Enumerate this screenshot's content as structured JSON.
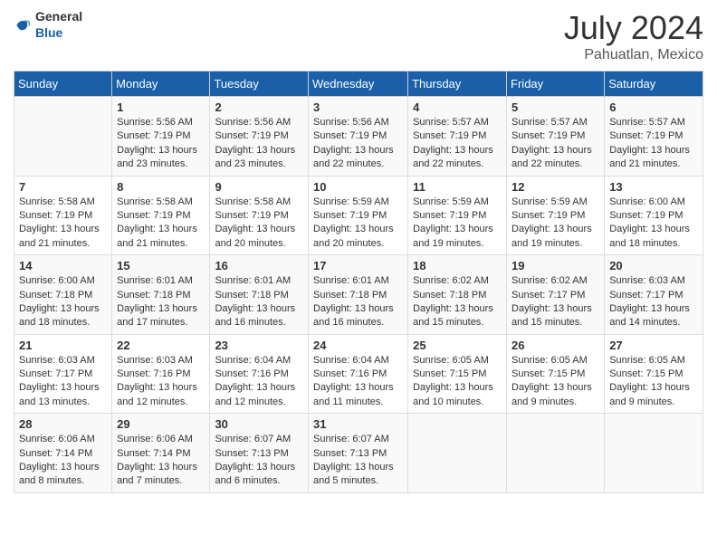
{
  "header": {
    "logo": {
      "general": "General",
      "blue": "Blue"
    },
    "title": "July 2024",
    "location": "Pahuatlan, Mexico"
  },
  "calendar": {
    "days_of_week": [
      "Sunday",
      "Monday",
      "Tuesday",
      "Wednesday",
      "Thursday",
      "Friday",
      "Saturday"
    ],
    "weeks": [
      [
        {
          "day": null
        },
        {
          "day": 1,
          "sunrise": "5:56 AM",
          "sunset": "7:19 PM",
          "daylight": "13 hours and 23 minutes."
        },
        {
          "day": 2,
          "sunrise": "5:56 AM",
          "sunset": "7:19 PM",
          "daylight": "13 hours and 23 minutes."
        },
        {
          "day": 3,
          "sunrise": "5:56 AM",
          "sunset": "7:19 PM",
          "daylight": "13 hours and 22 minutes."
        },
        {
          "day": 4,
          "sunrise": "5:57 AM",
          "sunset": "7:19 PM",
          "daylight": "13 hours and 22 minutes."
        },
        {
          "day": 5,
          "sunrise": "5:57 AM",
          "sunset": "7:19 PM",
          "daylight": "13 hours and 22 minutes."
        },
        {
          "day": 6,
          "sunrise": "5:57 AM",
          "sunset": "7:19 PM",
          "daylight": "13 hours and 21 minutes."
        }
      ],
      [
        {
          "day": 7,
          "sunrise": "5:58 AM",
          "sunset": "7:19 PM",
          "daylight": "13 hours and 21 minutes."
        },
        {
          "day": 8,
          "sunrise": "5:58 AM",
          "sunset": "7:19 PM",
          "daylight": "13 hours and 21 minutes."
        },
        {
          "day": 9,
          "sunrise": "5:58 AM",
          "sunset": "7:19 PM",
          "daylight": "13 hours and 20 minutes."
        },
        {
          "day": 10,
          "sunrise": "5:59 AM",
          "sunset": "7:19 PM",
          "daylight": "13 hours and 20 minutes."
        },
        {
          "day": 11,
          "sunrise": "5:59 AM",
          "sunset": "7:19 PM",
          "daylight": "13 hours and 19 minutes."
        },
        {
          "day": 12,
          "sunrise": "5:59 AM",
          "sunset": "7:19 PM",
          "daylight": "13 hours and 19 minutes."
        },
        {
          "day": 13,
          "sunrise": "6:00 AM",
          "sunset": "7:19 PM",
          "daylight": "13 hours and 18 minutes."
        }
      ],
      [
        {
          "day": 14,
          "sunrise": "6:00 AM",
          "sunset": "7:18 PM",
          "daylight": "13 hours and 18 minutes."
        },
        {
          "day": 15,
          "sunrise": "6:01 AM",
          "sunset": "7:18 PM",
          "daylight": "13 hours and 17 minutes."
        },
        {
          "day": 16,
          "sunrise": "6:01 AM",
          "sunset": "7:18 PM",
          "daylight": "13 hours and 16 minutes."
        },
        {
          "day": 17,
          "sunrise": "6:01 AM",
          "sunset": "7:18 PM",
          "daylight": "13 hours and 16 minutes."
        },
        {
          "day": 18,
          "sunrise": "6:02 AM",
          "sunset": "7:18 PM",
          "daylight": "13 hours and 15 minutes."
        },
        {
          "day": 19,
          "sunrise": "6:02 AM",
          "sunset": "7:17 PM",
          "daylight": "13 hours and 15 minutes."
        },
        {
          "day": 20,
          "sunrise": "6:03 AM",
          "sunset": "7:17 PM",
          "daylight": "13 hours and 14 minutes."
        }
      ],
      [
        {
          "day": 21,
          "sunrise": "6:03 AM",
          "sunset": "7:17 PM",
          "daylight": "13 hours and 13 minutes."
        },
        {
          "day": 22,
          "sunrise": "6:03 AM",
          "sunset": "7:16 PM",
          "daylight": "13 hours and 12 minutes."
        },
        {
          "day": 23,
          "sunrise": "6:04 AM",
          "sunset": "7:16 PM",
          "daylight": "13 hours and 12 minutes."
        },
        {
          "day": 24,
          "sunrise": "6:04 AM",
          "sunset": "7:16 PM",
          "daylight": "13 hours and 11 minutes."
        },
        {
          "day": 25,
          "sunrise": "6:05 AM",
          "sunset": "7:15 PM",
          "daylight": "13 hours and 10 minutes."
        },
        {
          "day": 26,
          "sunrise": "6:05 AM",
          "sunset": "7:15 PM",
          "daylight": "13 hours and 9 minutes."
        },
        {
          "day": 27,
          "sunrise": "6:05 AM",
          "sunset": "7:15 PM",
          "daylight": "13 hours and 9 minutes."
        }
      ],
      [
        {
          "day": 28,
          "sunrise": "6:06 AM",
          "sunset": "7:14 PM",
          "daylight": "13 hours and 8 minutes."
        },
        {
          "day": 29,
          "sunrise": "6:06 AM",
          "sunset": "7:14 PM",
          "daylight": "13 hours and 7 minutes."
        },
        {
          "day": 30,
          "sunrise": "6:07 AM",
          "sunset": "7:13 PM",
          "daylight": "13 hours and 6 minutes."
        },
        {
          "day": 31,
          "sunrise": "6:07 AM",
          "sunset": "7:13 PM",
          "daylight": "13 hours and 5 minutes."
        },
        {
          "day": null
        },
        {
          "day": null
        },
        {
          "day": null
        }
      ]
    ]
  }
}
